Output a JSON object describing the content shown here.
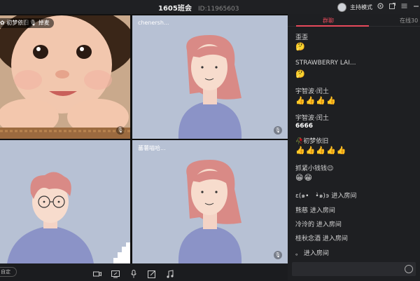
{
  "window": {
    "title": "1605班会",
    "room_id": "ID:11965603",
    "host_label": "主持模式"
  },
  "tiles": [
    {
      "name": "",
      "badge1": "初梦依旧",
      "badge2": "掉麦"
    },
    {
      "name": "chenersh..."
    },
    {
      "name": ""
    },
    {
      "name": "蕃薯喵哈..."
    }
  ],
  "toolbar": {
    "left_button": "自定",
    "icons": [
      "camera-icon",
      "screen-share-icon",
      "microphone-icon",
      "edit-icon",
      "music-icon"
    ]
  },
  "chat": {
    "tabs": {
      "group": "群聊",
      "online": "在线30"
    },
    "messages": [
      {
        "type": "text",
        "text": "歪歪"
      },
      {
        "type": "emoji",
        "items": [
          "🤔"
        ]
      },
      {
        "type": "text",
        "text": "STRAWBERRY LAI..."
      },
      {
        "type": "emoji",
        "items": [
          "🤔"
        ]
      },
      {
        "type": "text",
        "text": "宇智波·闰土"
      },
      {
        "type": "emoji",
        "items": [
          "👍",
          "👍",
          "👍",
          "👍"
        ]
      },
      {
        "type": "text",
        "text": "宇智波·闰土"
      },
      {
        "type": "text",
        "text": "6666",
        "bright": true
      },
      {
        "type": "text",
        "text": "🥀初梦依旧"
      },
      {
        "type": "emoji",
        "items": [
          "👍",
          "👍",
          "👍",
          "👍",
          "👍"
        ]
      },
      {
        "type": "text",
        "text": "抓紧小钱钱😉"
      },
      {
        "type": "emoji",
        "items": [
          "😁",
          "😁"
        ]
      },
      {
        "type": "text",
        "text": "ε(๑•　•̀๑)϶ 进入房间"
      },
      {
        "type": "text",
        "text": "熊慈 进入房间"
      },
      {
        "type": "text",
        "text": "冷泠的 进入房间"
      },
      {
        "type": "text",
        "text": "桂秋念酒 进入房间"
      },
      {
        "type": "text",
        "text": "。 进入房间"
      }
    ]
  },
  "colors": {
    "accent": "#e74a5b",
    "tile_bg": "#b7c1d4",
    "shirt": "#8b93c7",
    "hair": "#d98a86"
  }
}
